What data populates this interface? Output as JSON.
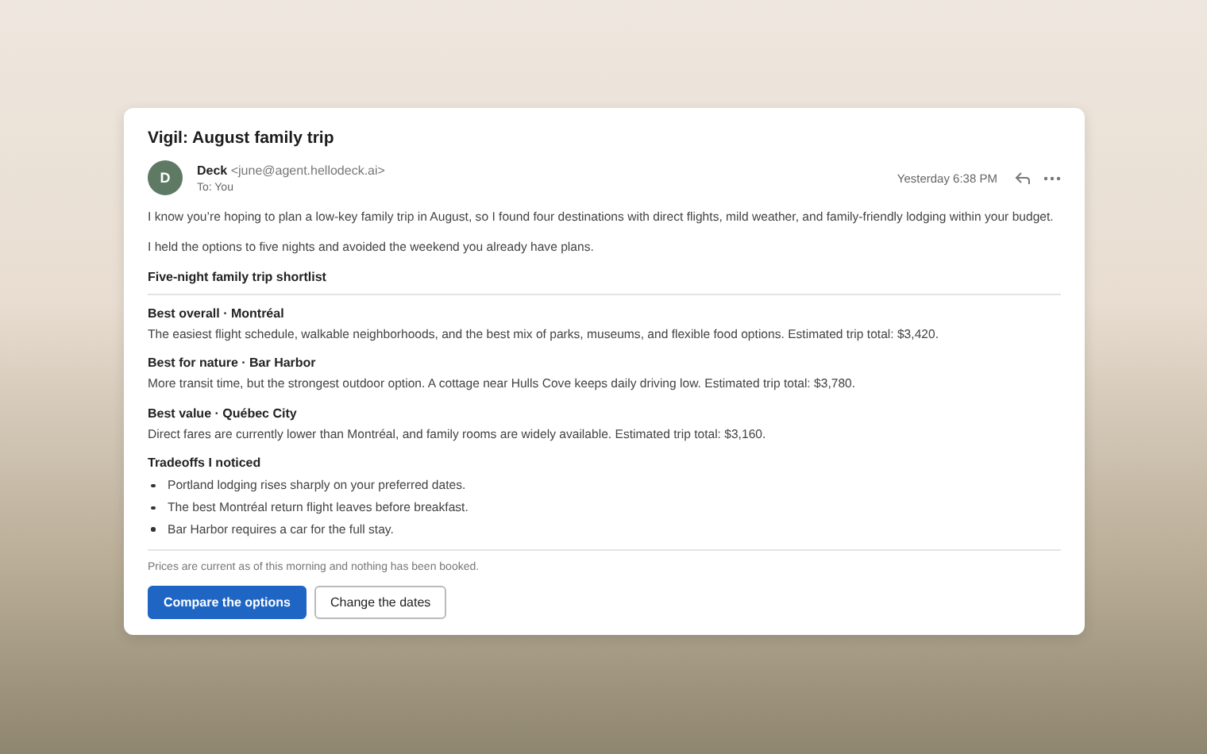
{
  "email": {
    "subject": "Vigil: August family trip",
    "sender_name": "Deck",
    "sender_address": "<june@agent.hellodeck.ai>",
    "avatar_initial": "D",
    "recipient": "To: You",
    "timestamp": "Yesterday 6:38 PM",
    "intro": [
      "I know you’re hoping to plan a low-key family trip in August, so I found four destinations with direct flights, mild weather, and family-friendly lodging within your budget.",
      "I held the options to five nights and avoided the weekend you already have plans."
    ],
    "shortlist_heading": "Five-night family trip shortlist",
    "options": [
      {
        "title": "Best overall · Montréal",
        "description": "The easiest flight schedule, walkable neighborhoods, and the best mix of parks, museums, and flexible food options. Estimated trip total: $3,420."
      },
      {
        "title": "Best for nature · Bar Harbor",
        "description": "More transit time, but the strongest outdoor option. A cottage near Hulls Cove keeps daily driving low. Estimated trip total: $3,780."
      },
      {
        "title": "Best value · Québec City",
        "description": "Direct fares are currently lower than Montréal, and family rooms are widely available. Estimated trip total: $3,160."
      }
    ],
    "tradeoffs_heading": "Tradeoffs I noticed",
    "tradeoffs": [
      "Portland lodging rises sharply on your preferred dates.",
      "The best Montréal return flight leaves before breakfast.",
      "Bar Harbor requires a car for the full stay."
    ],
    "footnote": "Prices are current as of this morning and nothing has been booked.",
    "buttons": [
      {
        "label": "Compare the options",
        "kind": "primary"
      },
      {
        "label": "Change the dates",
        "kind": "secondary"
      }
    ]
  }
}
